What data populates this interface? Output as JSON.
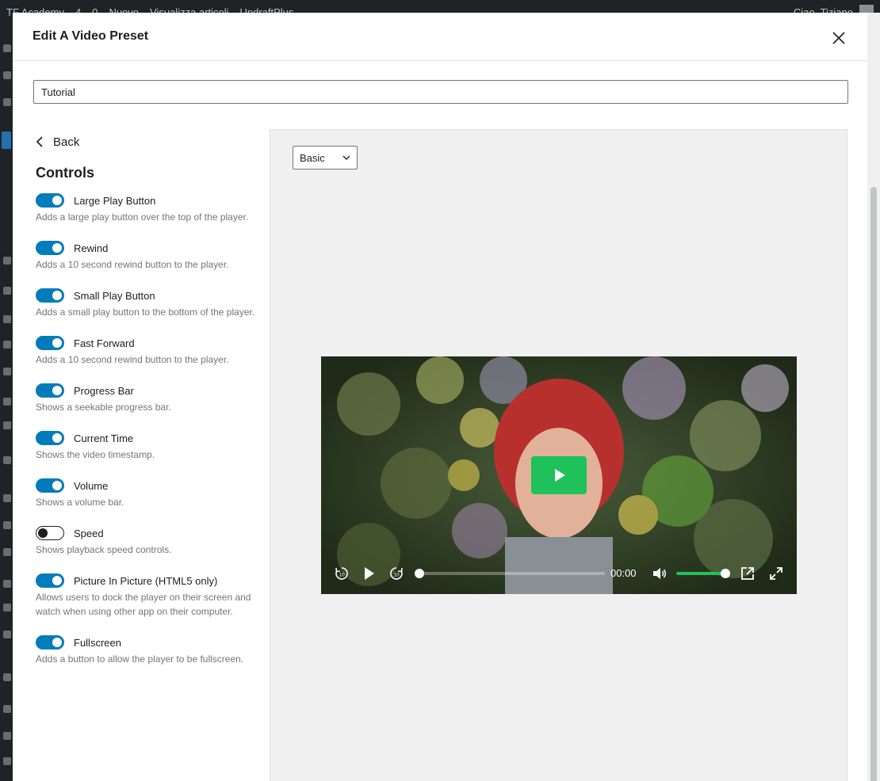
{
  "admin_bar": {
    "items": [
      "TF Academy",
      "4",
      "0",
      "Nuovo",
      "Visualizza articoli",
      "UpdraftPlus"
    ],
    "user": "Ciao, Tiziano"
  },
  "modal": {
    "title": "Edit A Video Preset",
    "close_icon": "close-icon"
  },
  "preset_name": {
    "value": "Tutorial"
  },
  "panel": {
    "back_label": "Back",
    "controls_title": "Controls",
    "controls": [
      {
        "label": "Large Play Button",
        "help": "Adds a large play button over the top of the player.",
        "enabled": true
      },
      {
        "label": "Rewind",
        "help": "Adds a 10 second rewind button to the player.",
        "enabled": true
      },
      {
        "label": "Small Play Button",
        "help": "Adds a small play button to the bottom of the player.",
        "enabled": true
      },
      {
        "label": "Fast Forward",
        "help": "Adds a 10 second rewind button to the player.",
        "enabled": true
      },
      {
        "label": "Progress Bar",
        "help": "Shows a seekable progress bar.",
        "enabled": true
      },
      {
        "label": "Current Time",
        "help": "Shows the video timestamp.",
        "enabled": true
      },
      {
        "label": "Volume",
        "help": "Shows a volume bar.",
        "enabled": true
      },
      {
        "label": "Speed",
        "help": "Shows playback speed controls.",
        "enabled": false
      },
      {
        "label": "Picture In Picture (HTML5 only)",
        "help": "Allows users to dock the player on their screen and watch when using other app on their computer.",
        "enabled": true
      },
      {
        "label": "Fullscreen",
        "help": "Adds a button to allow the player to be fullscreen.",
        "enabled": true
      }
    ]
  },
  "preview": {
    "style_select": "Basic",
    "player": {
      "current_time": "00:00",
      "progress": 0,
      "volume": 1,
      "accent_color": "#1ec15a",
      "icons": [
        "rewind-10-icon",
        "play-icon",
        "forward-10-icon",
        "volume-icon",
        "picture-in-picture-icon",
        "fullscreen-icon"
      ]
    }
  }
}
